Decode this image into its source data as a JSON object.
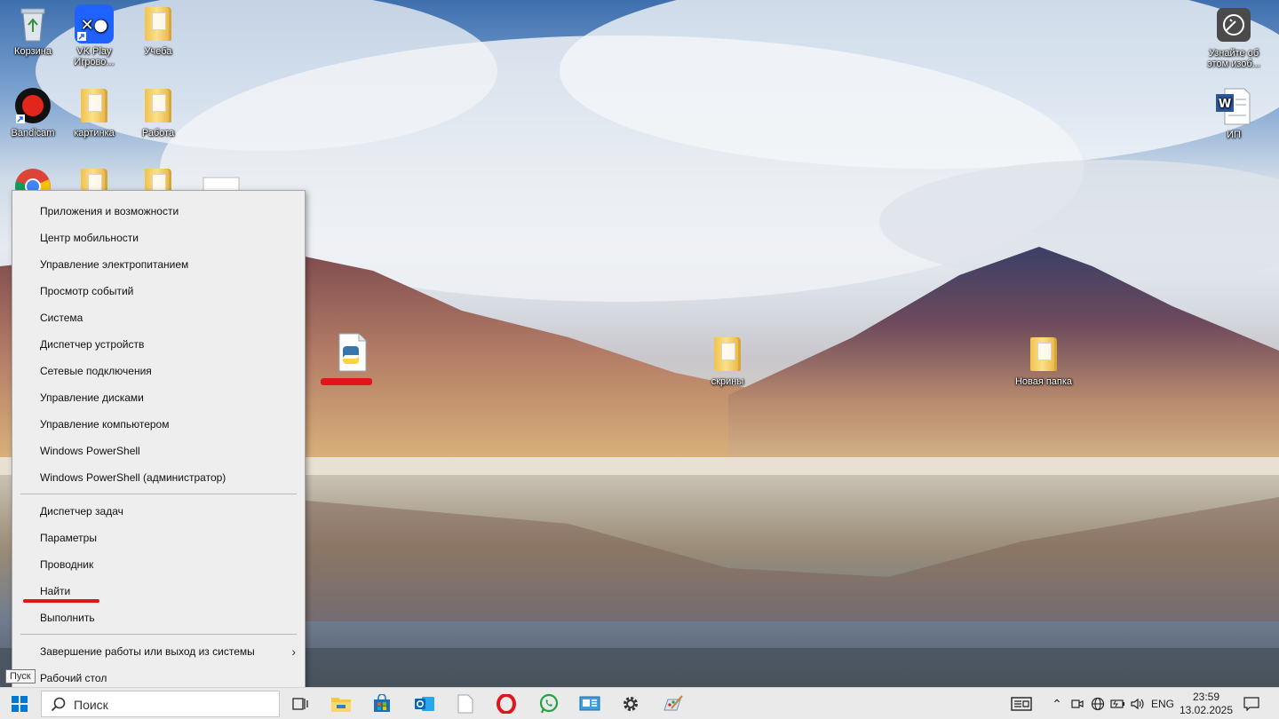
{
  "desktop": {
    "icons": [
      {
        "label": "Корзина",
        "icon": "recycle-bin-icon"
      },
      {
        "label": "VK Play Игрово...",
        "icon": "vk-play-icon"
      },
      {
        "label": "Учеба",
        "icon": "folder-icon"
      },
      {
        "label": "Bandicam",
        "icon": "bandicam-icon"
      },
      {
        "label": "картинка",
        "icon": "folder-icon"
      },
      {
        "label": "Работа",
        "icon": "folder-icon"
      },
      {
        "label": "скрины",
        "icon": "folder-icon"
      },
      {
        "label": "Новая папка",
        "icon": "folder-icon"
      },
      {
        "label": "Узнайте об этом изоб...",
        "icon": "spotlight-info-icon"
      },
      {
        "label": "ИП",
        "icon": "word-document-icon"
      }
    ]
  },
  "context_menu": {
    "items": [
      "Приложения и возможности",
      "Центр мобильности",
      "Управление электропитанием",
      "Просмотр событий",
      "Система",
      "Диспетчер устройств",
      "Сетевые подключения",
      "Управление дисками",
      "Управление компьютером",
      "Windows PowerShell",
      "Windows PowerShell (администратор)",
      "Диспетчер задач",
      "Параметры",
      "Проводник",
      "Найти",
      "Выполнить",
      "Завершение работы или выход из системы",
      "Рабочий стол"
    ]
  },
  "tooltip": "Пуск",
  "taskbar": {
    "search_placeholder": "Поиск",
    "pinned": [
      "file-explorer-icon",
      "microsoft-store-icon",
      "outlook-icon",
      "blank-file-icon",
      "opera-icon",
      "whatsapp-icon",
      "control-panel-icon",
      "settings-icon",
      "paint-icon"
    ],
    "language": "ENG",
    "time": "23:59",
    "date": "13.02.2025"
  },
  "colors": {
    "accent": "#0078d7",
    "annotation": "#e0161c"
  }
}
